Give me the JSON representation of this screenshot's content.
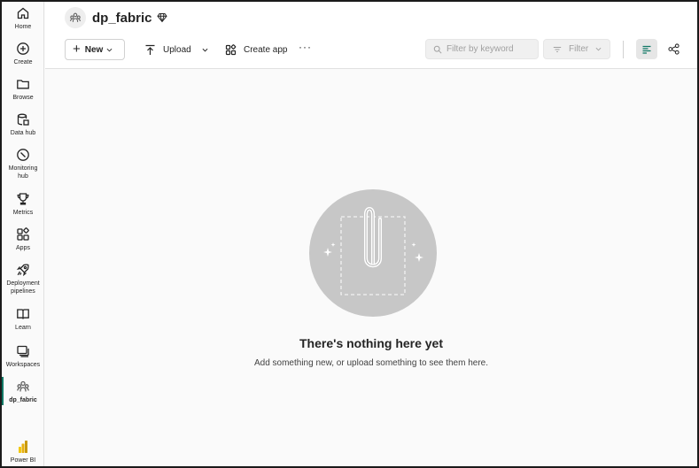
{
  "nav": {
    "items": [
      {
        "label": "Home"
      },
      {
        "label": "Create"
      },
      {
        "label": "Browse"
      },
      {
        "label": "Data hub"
      },
      {
        "label": "Monitoring hub"
      },
      {
        "label": "Metrics"
      },
      {
        "label": "Apps"
      },
      {
        "label": "Deployment pipelines"
      },
      {
        "label": "Learn"
      },
      {
        "label": "Workspaces"
      },
      {
        "label": "dp_fabric"
      }
    ],
    "brand": "Power BI"
  },
  "workspace": {
    "title": "dp_fabric"
  },
  "toolbar": {
    "new_label": "New",
    "upload_label": "Upload",
    "create_app_label": "Create app",
    "more_label": "···",
    "search_placeholder": "Filter by keyword",
    "filter_label": "Filter"
  },
  "empty_state": {
    "title": "There's nothing here yet",
    "subtitle": "Add something new, or upload something to see them here."
  },
  "colors": {
    "accent": "#117865",
    "powerbi_yellow": "#F2C811",
    "illustration": "#c7c7c7"
  }
}
